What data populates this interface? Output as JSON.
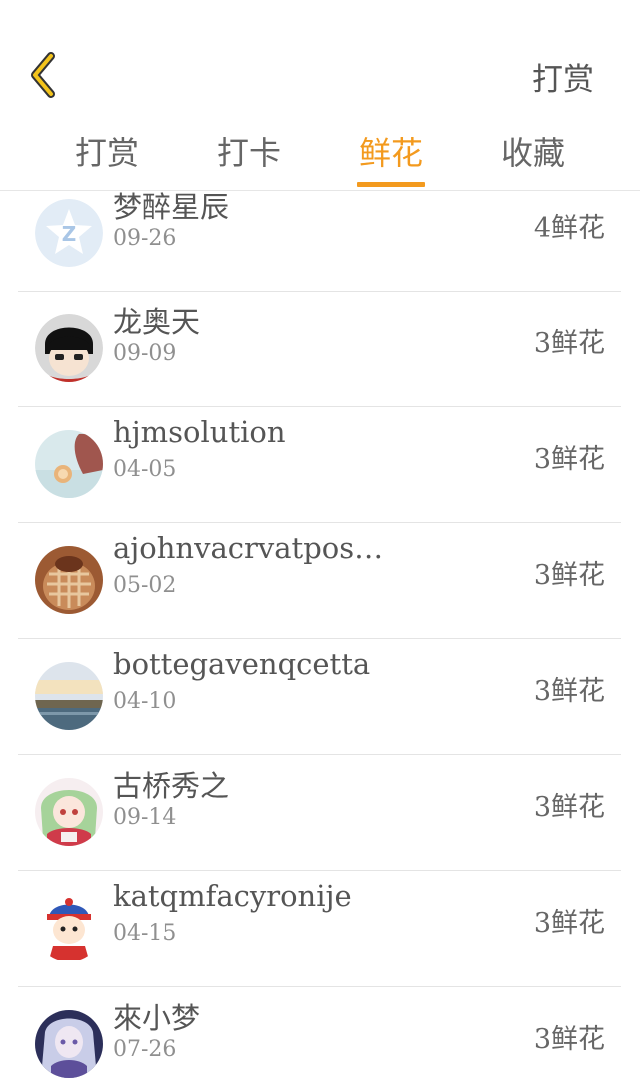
{
  "header": {
    "back_icon": "chevron-left-icon",
    "action_label": "打赏"
  },
  "tabs": [
    {
      "label": "打赏",
      "active": false
    },
    {
      "label": "打卡",
      "active": false
    },
    {
      "label": "鲜花",
      "active": true
    },
    {
      "label": "收藏",
      "active": false
    }
  ],
  "colors": {
    "accent": "#f39a1e",
    "text": "#555555",
    "subtext": "#8f8f8f",
    "divider": "#e4e4e4"
  },
  "items": [
    {
      "name": "梦醉星辰",
      "date": "09-26",
      "count": "4鲜花",
      "avatar": "qq-logo-avatar"
    },
    {
      "name": "龙奥天",
      "date": "09-09",
      "count": "3鲜花",
      "avatar": "cartoon-boy-avatar"
    },
    {
      "name": "hjmsolution",
      "date": "04-05",
      "count": "3鲜花",
      "avatar": "girl-photo-avatar"
    },
    {
      "name": "ajohnvacrvatpos…",
      "date": "05-02",
      "count": "3鲜花",
      "avatar": "woven-photo-avatar"
    },
    {
      "name": "bottegavenqcetta",
      "date": "04-10",
      "count": "3鲜花",
      "avatar": "landscape-avatar"
    },
    {
      "name": "古桥秀之",
      "date": "09-14",
      "count": "3鲜花",
      "avatar": "anime-girl-avatar"
    },
    {
      "name": "katqmfacyronije",
      "date": "04-15",
      "count": "3鲜花",
      "avatar": "cartoon-character-avatar"
    },
    {
      "name": "來小梦",
      "date": "07-26",
      "count": "3鲜花",
      "avatar": "anime-portrait-avatar"
    }
  ]
}
